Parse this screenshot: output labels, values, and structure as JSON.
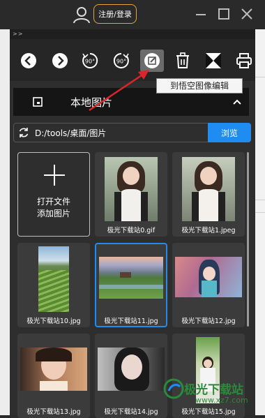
{
  "titlebar": {
    "login_label": "注册/登录",
    "icons": [
      "user-icon",
      "minimize-icon",
      "maximize-icon",
      "close-icon"
    ]
  },
  "breadcrumb": ">>",
  "toolbar": {
    "buttons": [
      "previous",
      "next",
      "rotate-left-90",
      "rotate-right-90",
      "edit-image",
      "delete",
      "flip",
      "print"
    ],
    "rotate_left_label": "90°",
    "rotate_right_label": "90°"
  },
  "tooltip": "到悟空图像编辑",
  "section": {
    "title": "本地图片"
  },
  "path_bar": {
    "path": "D:/tools/桌面/图片",
    "browse_label": "浏览"
  },
  "add_tile": {
    "line1": "打开文件",
    "line2": "添加图片"
  },
  "files": [
    "极光下载站0.gif",
    "极光下载站1.jpeg",
    "极光下载站10.jpg",
    "极光下载站11.jpg",
    "极光下载站12.jpg",
    "极光下载站13.jpg",
    "极光下载站14.jpg",
    "极光下载站15.jpg"
  ],
  "selected_file": "极光下载站11.jpg",
  "watermark": {
    "name": "极光下载站",
    "url": "www.xz7.com"
  },
  "colors": {
    "accent": "#1e8cf0",
    "login_border": "#e8a23a",
    "arrow": "#d8262a"
  }
}
